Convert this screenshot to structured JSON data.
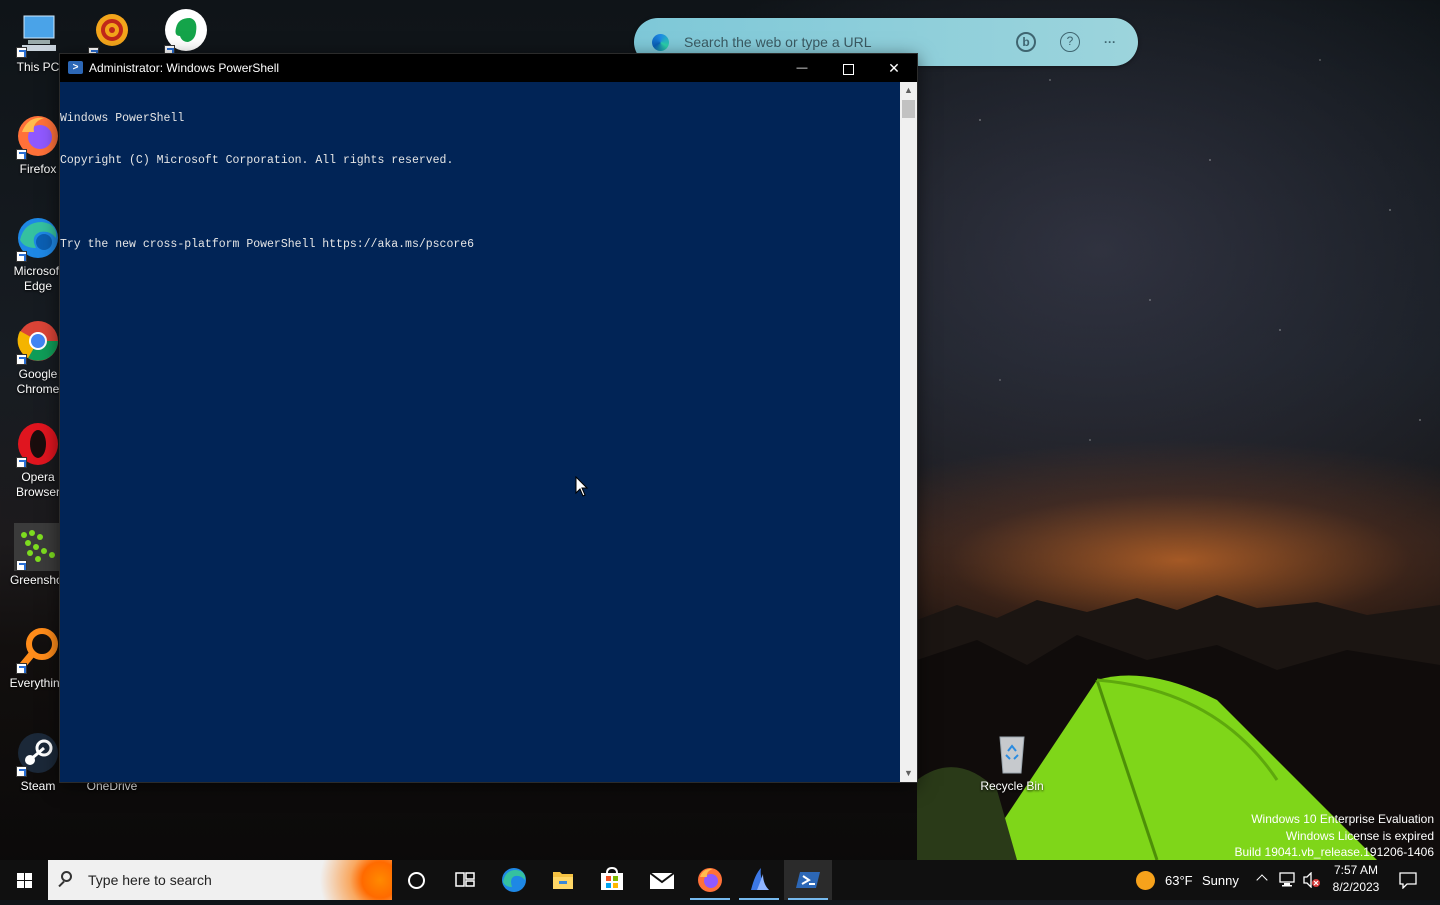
{
  "desktop": {
    "icons": [
      {
        "label": "This PC"
      },
      {
        "label": "Firefox"
      },
      {
        "label": "Microsoft Edge"
      },
      {
        "label": "Google Chrome"
      },
      {
        "label": "Opera Browser"
      },
      {
        "label": "Greenshot"
      },
      {
        "label": "Everything"
      },
      {
        "label": "Steam"
      },
      {
        "label": "OneDrive"
      },
      {
        "label": "Recycle Bin"
      }
    ]
  },
  "edge_bar": {
    "placeholder": "Search the web or type a URL",
    "help_glyph": "?",
    "more_glyph": "···"
  },
  "powershell": {
    "title": "Administrator: Windows PowerShell",
    "lines": [
      "Windows PowerShell",
      "Copyright (C) Microsoft Corporation. All rights reserved.",
      "",
      "Try the new cross-platform PowerShell https://aka.ms/pscore6"
    ],
    "minimize_glyph": "—",
    "close_glyph": "✕"
  },
  "watermark": {
    "line1": "Windows 10 Enterprise Evaluation",
    "line2": "Windows License is expired",
    "line3": "Build 19041.vb_release.191206-1406"
  },
  "taskbar": {
    "search_placeholder": "Type here to search",
    "weather_temp": "63°F",
    "weather_desc": "Sunny",
    "time": "7:57 AM",
    "date": "8/2/2023"
  },
  "colors": {
    "powershell_bg": "#012456",
    "taskbar_bg": "#101010",
    "accent": "#76b9ed"
  }
}
